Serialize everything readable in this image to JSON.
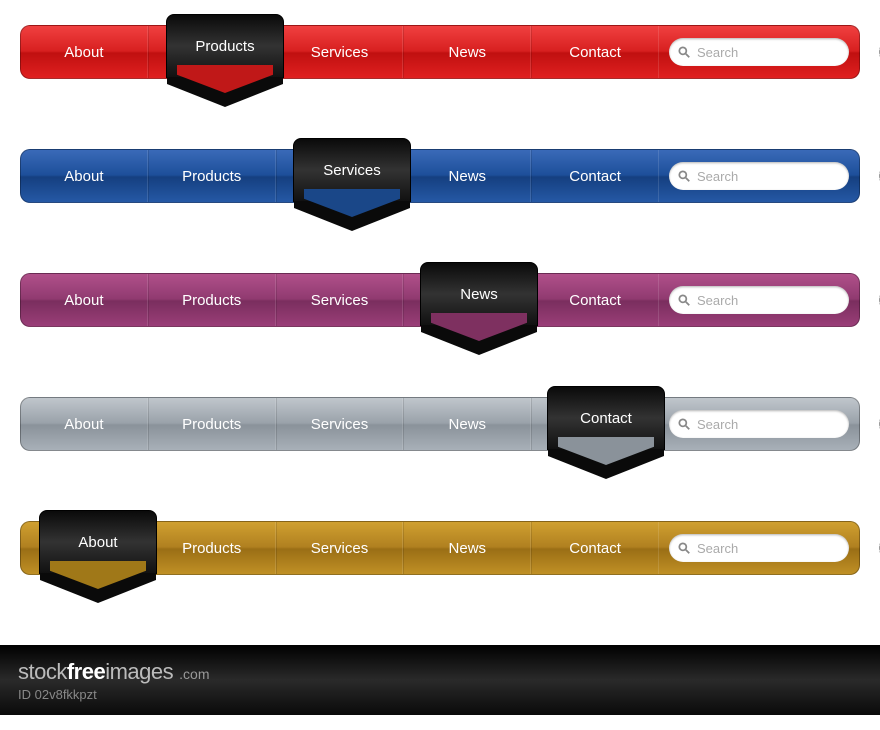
{
  "nav": {
    "items": [
      "About",
      "Products",
      "Services",
      "News",
      "Contact"
    ],
    "search_placeholder": "Search"
  },
  "bars": [
    {
      "theme": "red",
      "active": 1
    },
    {
      "theme": "blue",
      "active": 2
    },
    {
      "theme": "purple",
      "active": 3
    },
    {
      "theme": "grey",
      "active": 4
    },
    {
      "theme": "gold",
      "active": 0
    }
  ],
  "footer": {
    "brand_left": "stock",
    "brand_mid": "free",
    "brand_right": "images",
    "domain_suffix": ".com",
    "id_label": "ID",
    "id_value": "02v8fkkpzt"
  }
}
